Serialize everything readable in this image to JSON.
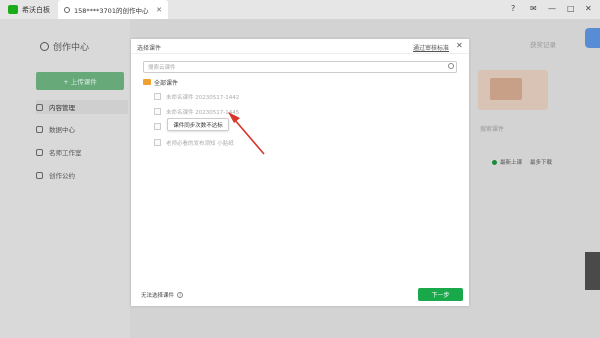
{
  "tabbar": {
    "app_name": "希沃白板",
    "doc_tab_label": "158****3701的创作中心",
    "close_glyph": "✕",
    "controls": [
      "?",
      "✉",
      "—",
      "□",
      "✕"
    ]
  },
  "sidebar": {
    "brand": "创作中心",
    "upload_label": "+ 上传课件",
    "items": [
      {
        "label": "内容管理",
        "active": true
      },
      {
        "label": "数据中心",
        "active": false
      },
      {
        "label": "名师工作室",
        "active": false
      },
      {
        "label": "创作公约",
        "active": false
      }
    ]
  },
  "background": {
    "top_right_link": "获奖记录",
    "search_placeholder": "搜索课件",
    "radio_1": "最新上课",
    "radio_2": "最多下载"
  },
  "modal": {
    "title": "选择课件",
    "link": "通过审核标准",
    "close_glyph": "✕",
    "search_placeholder": "搜索云课件",
    "folder_label": "全部课件",
    "items": [
      "未命名课件 20230517-1442",
      "未命名课件 20230517-1445",
      "",
      "老师必看的发布须知 小贴纸"
    ],
    "tooltip": "课件同步次数不达标",
    "bottom_text": "无法选择课件",
    "next_button": "下一步"
  },
  "colors": {
    "accent": "#19a94b",
    "arrow": "#d9352b",
    "folder": "#f0a030"
  }
}
